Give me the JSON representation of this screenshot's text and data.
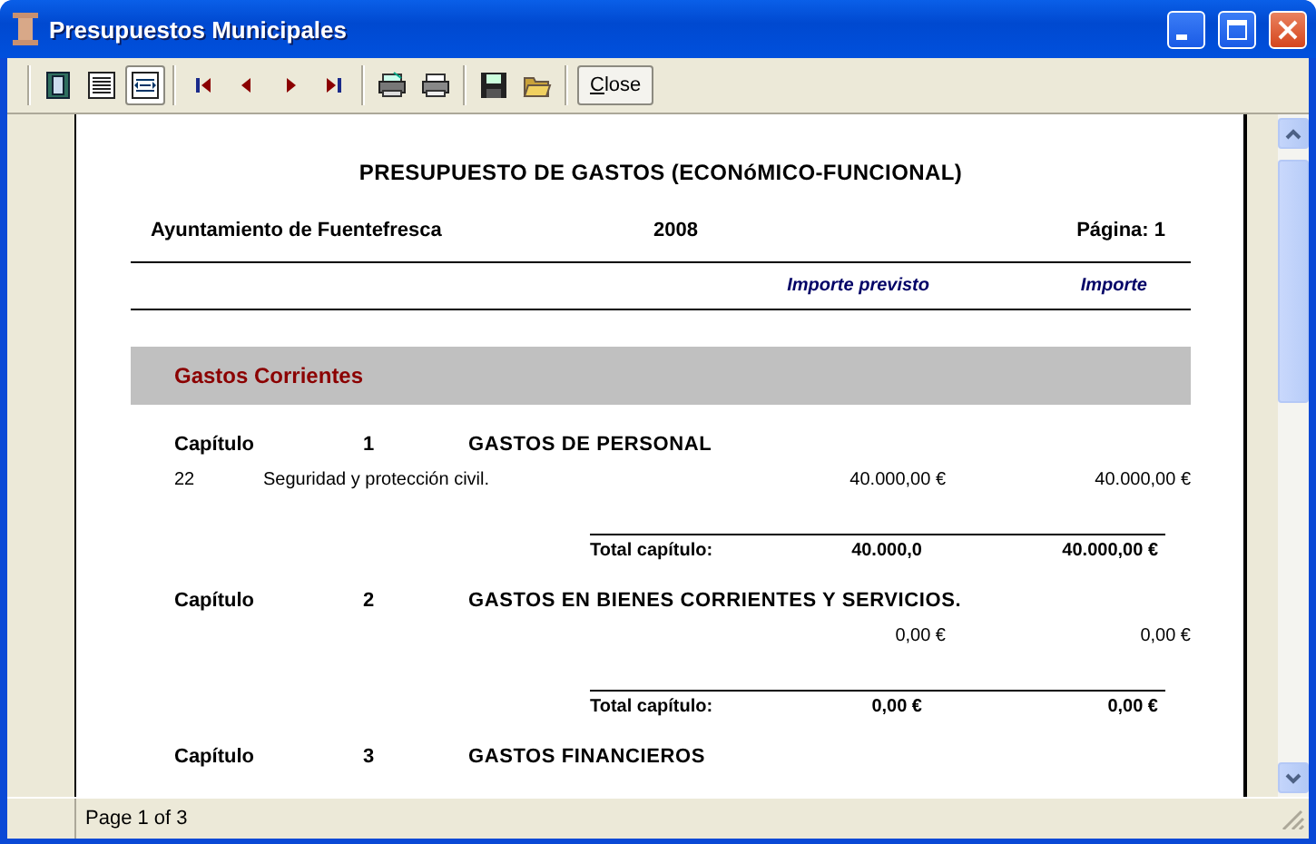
{
  "window": {
    "title": "Presupuestos Municipales"
  },
  "toolbar": {
    "buttons": [
      {
        "kind": "one-page",
        "selected": false
      },
      {
        "kind": "lines",
        "selected": false
      },
      {
        "kind": "fit-width",
        "selected": true
      },
      {
        "kind": "first",
        "selected": false
      },
      {
        "kind": "prev",
        "selected": false
      },
      {
        "kind": "next",
        "selected": false
      },
      {
        "kind": "last",
        "selected": false
      },
      {
        "kind": "print-setup",
        "selected": false
      },
      {
        "kind": "print",
        "selected": false
      },
      {
        "kind": "save",
        "selected": false
      },
      {
        "kind": "open",
        "selected": false
      },
      {
        "kind": "text",
        "label": "Close",
        "selected": false
      }
    ]
  },
  "report": {
    "title": "PRESUPUESTO DE GASTOS (ECONóMICO-FUNCIONAL)",
    "entity": "Ayuntamiento de Fuentefresca",
    "year": "2008",
    "page": "Página: 1",
    "columns": [
      "Importe previsto",
      "Importe"
    ],
    "sections": [
      {
        "title": "Gastos Corrientes",
        "chapters": [
          {
            "label": "Capítulo",
            "number": "1",
            "name": "GASTOS DE PERSONAL",
            "items": [
              {
                "code": "22",
                "description": "Seguridad y protección civil.",
                "planned": "40.000,00 €",
                "amount": "40.000,00 €"
              }
            ],
            "total": {
              "label": "Total capítulo:",
              "planned": "40.000,0",
              "amount": "40.000,00 €"
            }
          },
          {
            "label": "Capítulo",
            "number": "2",
            "name": "GASTOS EN BIENES CORRIENTES Y SERVICIOS.",
            "items": [
              {
                "planned": "0,00 €",
                "amount": "0,00 €"
              }
            ],
            "total": {
              "label": "Total capítulo:",
              "planned": "0,00 €",
              "amount": "0,00 €"
            }
          },
          {
            "label": "Capítulo",
            "number": "3",
            "name": "GASTOS FINANCIEROS"
          }
        ]
      }
    ]
  },
  "status_bar": {
    "text": "Page 1 of 3"
  }
}
